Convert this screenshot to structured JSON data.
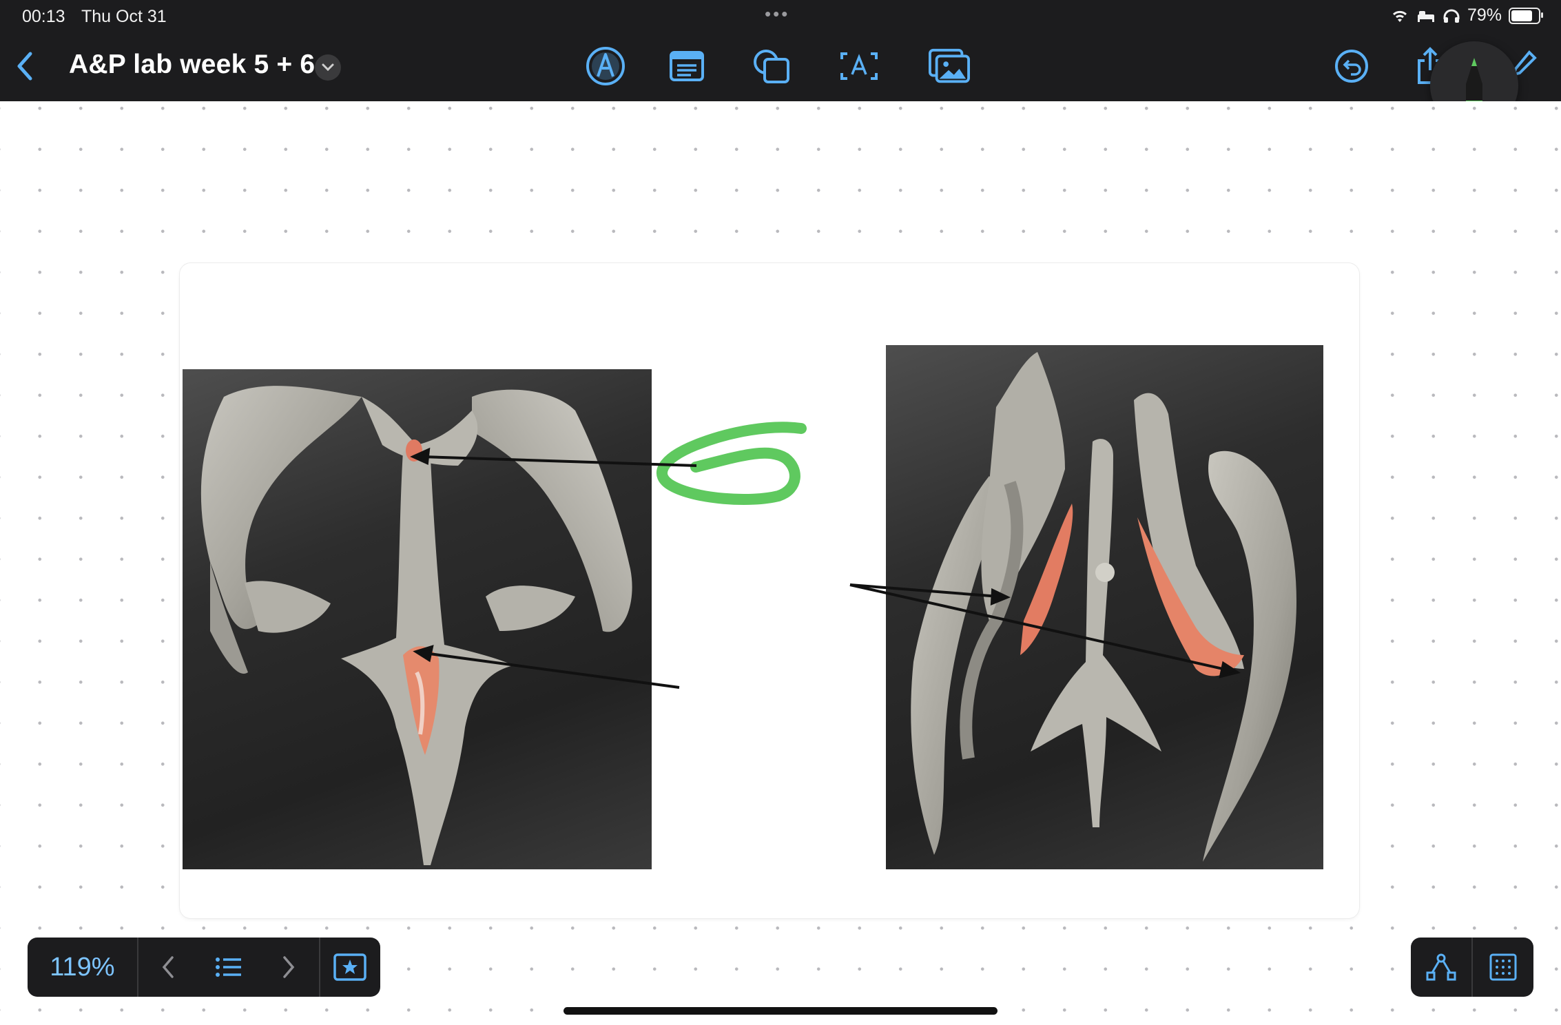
{
  "status_bar": {
    "time": "00:13",
    "date": "Thu Oct 31",
    "battery_percent": "79%",
    "battery_level": 0.79
  },
  "toolbar": {
    "title": "A&P lab week 5 + 6",
    "tools": [
      "pen-tool-icon",
      "text-box-icon",
      "shapes-icon",
      "text-icon",
      "media-icon"
    ],
    "accent_color": "#5ab0f5"
  },
  "canvas": {
    "annotation_color": "#5fc95f",
    "arrow_color": "#111111"
  },
  "bottom_bar": {
    "zoom": "119%"
  }
}
